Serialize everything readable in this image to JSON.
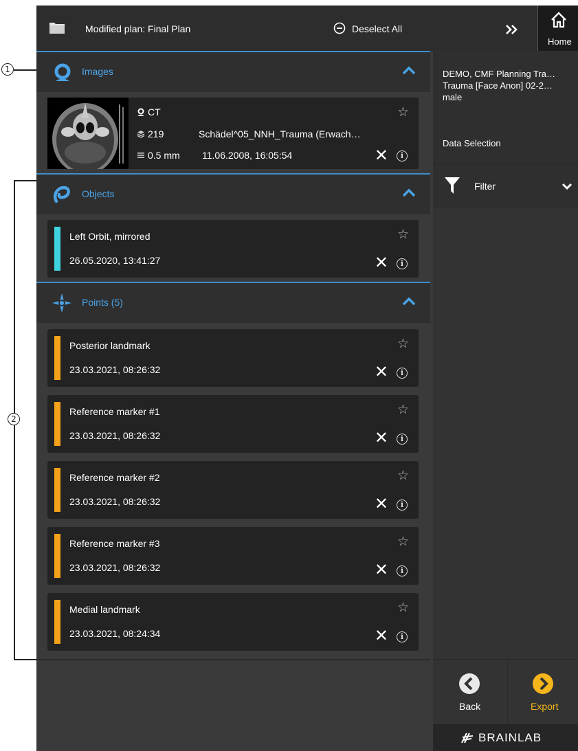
{
  "callouts": {
    "one": "1",
    "two": "2"
  },
  "topbar": {
    "folder_icon": "folder-icon",
    "plan_title": "Modified plan: Final Plan",
    "deselect_all": "Deselect All",
    "expand_icon": "double-chevron-right-icon",
    "home_label": "Home"
  },
  "sections": {
    "images": {
      "title": "Images"
    },
    "objects": {
      "title": "Objects"
    },
    "points": {
      "title": "Points (5)"
    }
  },
  "image_card": {
    "modality": "CT",
    "slices": "219",
    "series_name": "Schädel^05_NNH_Trauma (Erwach…",
    "slice_thickness": "0.5 mm",
    "datetime": "11.06.2008, 16:05:54"
  },
  "objects": [
    {
      "name": "Left Orbit, mirrored",
      "date": "26.05.2020, 13:41:27",
      "color": "#3fd3e0"
    }
  ],
  "points": [
    {
      "name": "Posterior landmark",
      "date": "23.03.2021, 08:26:32",
      "color": "#f5a21b"
    },
    {
      "name": "Reference marker #1",
      "date": "23.03.2021, 08:26:32",
      "color": "#f5a21b"
    },
    {
      "name": "Reference marker #2",
      "date": "23.03.2021, 08:26:32",
      "color": "#f5a21b"
    },
    {
      "name": "Reference marker #3",
      "date": "23.03.2021, 08:26:32",
      "color": "#f5a21b"
    },
    {
      "name": "Medial landmark",
      "date": "23.03.2021, 08:24:34",
      "color": "#f5a21b"
    }
  ],
  "right_panel": {
    "patient_line1": "DEMO, CMF Planning Tra…",
    "patient_line2": "Trauma [Face Anon] 02-2…",
    "patient_line3": "male",
    "data_selection": "Data Selection",
    "filter": "Filter",
    "back": "Back",
    "export": "Export",
    "brand": "BRAINLAB"
  },
  "colors": {
    "accent_blue": "#4aa3e6",
    "object_cyan": "#3fd3e0",
    "point_orange": "#f5a21b",
    "export_yellow": "#f5b51b"
  }
}
